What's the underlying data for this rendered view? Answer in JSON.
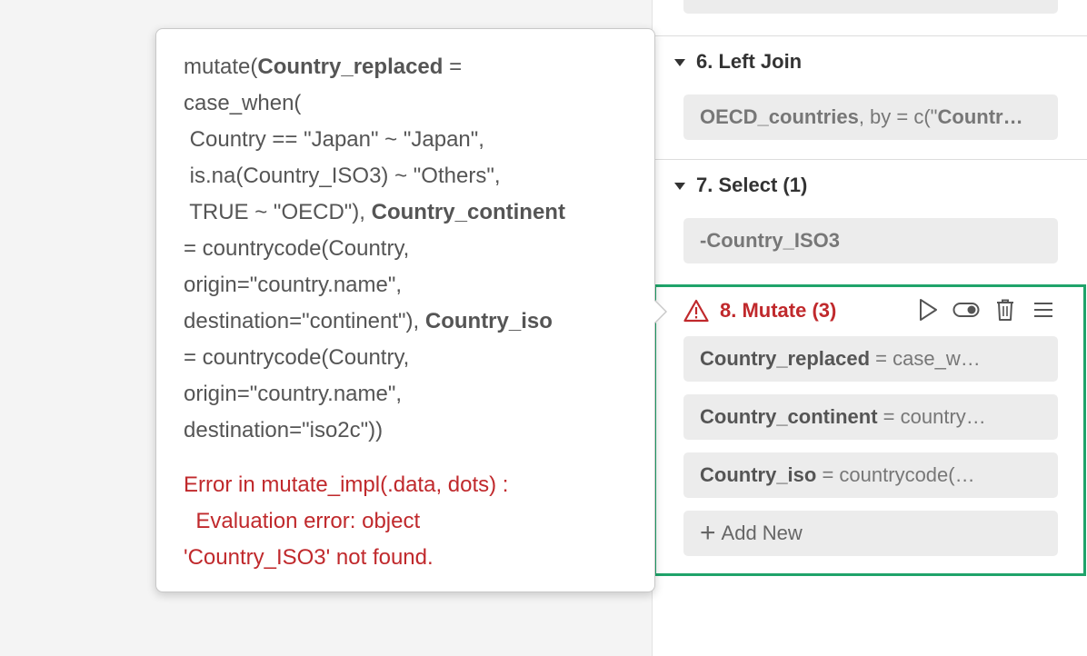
{
  "colors": {
    "accent_green": "#1fa36a",
    "error_red": "#c0292c"
  },
  "steps": [
    {
      "header": "6. Left Join",
      "chip_bold": "OECD_countries",
      "chip_rest": ", by = c(\"",
      "chip_bold2": "Countr…"
    },
    {
      "header": "7. Select (1)",
      "chip_bold": "-Country_ISO3"
    }
  ],
  "mutate": {
    "header": "8. Mutate (3)",
    "warning_icon": "warning-triangle-icon",
    "tools": [
      "play-icon",
      "toggle-icon",
      "trash-icon",
      "menu-icon"
    ],
    "items": [
      {
        "name": "Country_replaced",
        "rest": " = case_w…"
      },
      {
        "name": "Country_continent",
        "rest": " = country…"
      },
      {
        "name": "Country_iso",
        "rest": " = countrycode(…"
      }
    ],
    "add_new": "Add New"
  },
  "popover": {
    "code": [
      {
        "pre": "mutate(",
        "bold": "Country_replaced",
        "post": " ="
      },
      {
        "pre": "case_when(",
        "bold": "",
        "post": ""
      },
      {
        "pre": " Country == \"Japan\" ~ \"Japan\",",
        "bold": "",
        "post": ""
      },
      {
        "pre": " is.na(Country_ISO3) ~ \"Others\",",
        "bold": "",
        "post": ""
      },
      {
        "pre": " TRUE ~ \"OECD\"), ",
        "bold": "Country_continent",
        "post": ""
      },
      {
        "pre": "= countrycode(Country,",
        "bold": "",
        "post": ""
      },
      {
        "pre": "origin=\"country.name\",",
        "bold": "",
        "post": ""
      },
      {
        "pre": "destination=\"continent\"), ",
        "bold": "Country_iso",
        "post": ""
      },
      {
        "pre": "= countrycode(Country,",
        "bold": "",
        "post": ""
      },
      {
        "pre": "origin=\"country.name\",",
        "bold": "",
        "post": ""
      },
      {
        "pre": "destination=\"iso2c\"))",
        "bold": "",
        "post": ""
      }
    ],
    "error": [
      "Error in mutate_impl(.data, dots) :",
      "  Evaluation error: object",
      "'Country_ISO3' not found."
    ]
  }
}
